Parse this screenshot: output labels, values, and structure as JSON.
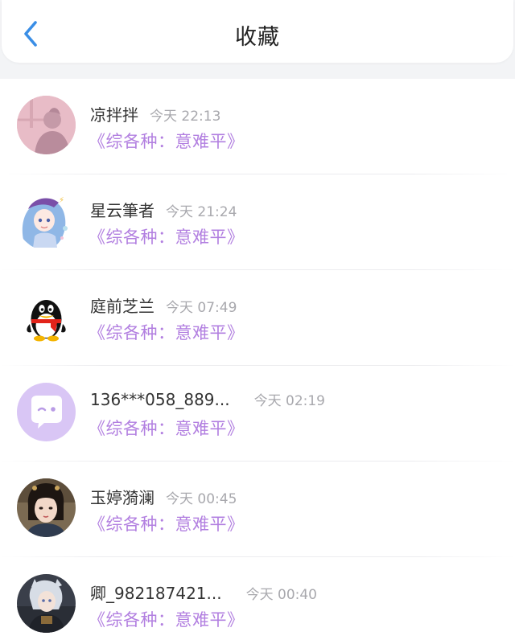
{
  "header": {
    "title": "收藏",
    "back_icon": "chevron-left-icon",
    "accent": "#3a8ee6"
  },
  "colors": {
    "book_link": "#b27fe0",
    "time": "#a8a8ad",
    "name": "#333333"
  },
  "favorites": [
    {
      "name": "凉拌拌",
      "time": "今天 22:13",
      "book": "《综各种：意难平》",
      "avatar": "pink-silhouette-avatar"
    },
    {
      "name": "星云筆者",
      "time": "今天 21:24",
      "book": "《综各种：意难平》",
      "avatar": "anime-girl-avatar"
    },
    {
      "name": "庭前芝兰",
      "time": "今天 07:49",
      "book": "《综各种：意难平》",
      "avatar": "penguin-avatar"
    },
    {
      "name": "136***058_889...",
      "time": "今天 02:19",
      "book": "《综各种：意难平》",
      "avatar": "chat-bubble-avatar"
    },
    {
      "name": "玉婷漪澜",
      "time": "今天 00:45",
      "book": "《综各种：意难平》",
      "avatar": "actress-photo-avatar"
    },
    {
      "name": "卿_982187421...",
      "time": "今天 00:40",
      "book": "《综各种：意难平》",
      "avatar": "anime-character-avatar"
    }
  ]
}
